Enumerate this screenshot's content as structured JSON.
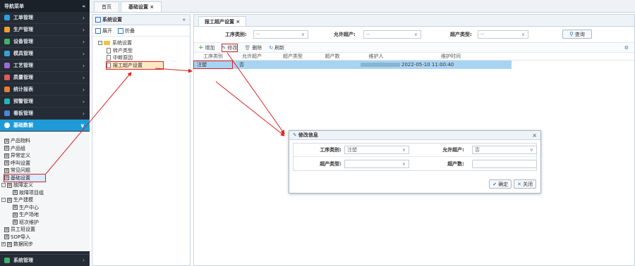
{
  "nav": {
    "header": "导航菜单",
    "collapse_icon": "«",
    "items": [
      {
        "label": "工单管理",
        "color": "#2f9fe0"
      },
      {
        "label": "生产管理",
        "color": "#f0a030"
      },
      {
        "label": "设备管理",
        "color": "#3fb26b"
      },
      {
        "label": "模具管理",
        "color": "#3aa0d8"
      },
      {
        "label": "工艺管理",
        "color": "#9c6ad8"
      },
      {
        "label": "质量管理",
        "color": "#e05a5a"
      },
      {
        "label": "统计报表",
        "color": "#f07a30"
      },
      {
        "label": "预警管理",
        "color": "#22b7b7"
      },
      {
        "label": "看板管理",
        "color": "#4a86d8"
      }
    ],
    "active_item": {
      "label": "基础数据",
      "color": "#ffffff"
    },
    "subtree": [
      "产品物料",
      "产品组",
      "异常定义",
      "呼叫设置",
      "常见问题",
      "基础设置"
    ],
    "fault_def": "故障定义",
    "fault_items": [
      "故障项目组"
    ],
    "production_model": "生产建模",
    "production_items": [
      "生产中心",
      "生产场地",
      "班次维护"
    ],
    "extra_items": [
      "员工班设置",
      "SOP导入",
      "数据同步"
    ],
    "bottom_item": "系统管理"
  },
  "topbar": {
    "tabs": [
      "首页",
      "基础设置 ×"
    ]
  },
  "tree_panel": {
    "title": "系统设置",
    "collapse_icon": "«",
    "expand_label": "展开",
    "collapse_label": "折叠",
    "root": "系统设置",
    "children": [
      "转产类型",
      "中断原因",
      "报工超产设置"
    ]
  },
  "main": {
    "tab": "报工超产设置 ×",
    "filters": {
      "process_label": "工序类别:",
      "process_value": "--",
      "allow_label": "允许超产:",
      "allow_value": "--",
      "type_label": "超产类型:",
      "type_value": "--",
      "query_label": "查询"
    },
    "toolbar": {
      "add": "增加",
      "edit": "修改",
      "delete": "删除",
      "refresh": "刷新"
    },
    "columns": [
      "工序类别",
      "允许超产",
      "超产类型",
      "超产数",
      "维护人",
      "维护时间"
    ],
    "row": {
      "process": "注塑",
      "allow": "否",
      "type": "",
      "count": "",
      "maintainer": "",
      "time": "2022-05-10 11:00:40"
    }
  },
  "modal": {
    "title": "修改信息",
    "close": "×",
    "process_label": "工序类别:",
    "process_value": "注塑",
    "allow_label": "允许超产:",
    "allow_value": "否",
    "type_label": "超产类型:",
    "count_label": "超产数:",
    "ok_label": "确定",
    "cancel_label": "关闭"
  }
}
